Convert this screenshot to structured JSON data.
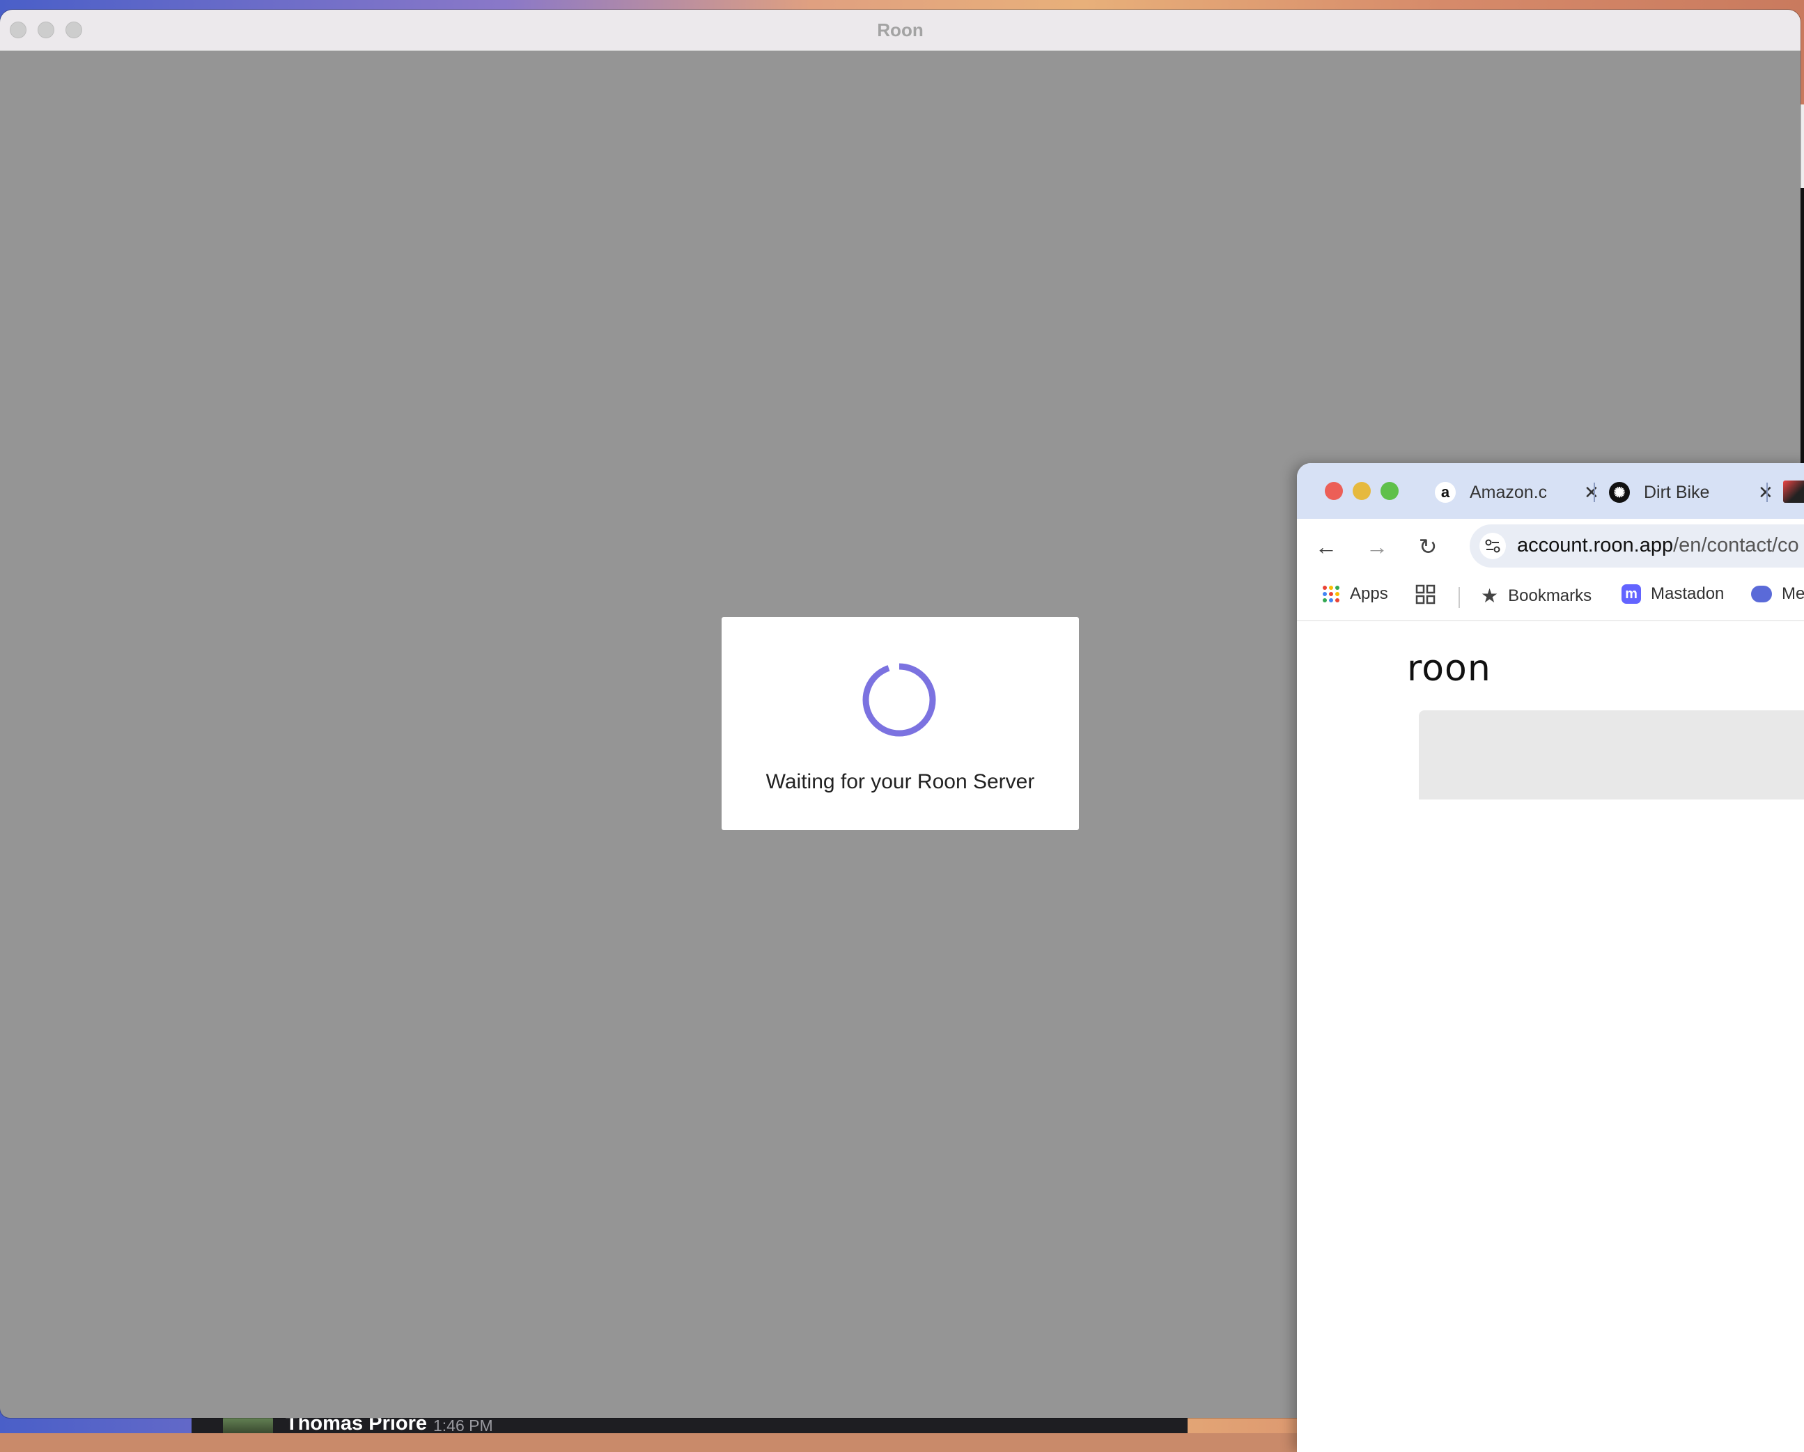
{
  "roon": {
    "title": "Roon",
    "dialog_message": "Waiting for your Roon Server",
    "spinner_color": "#7b72e0"
  },
  "chrome": {
    "tabs": [
      {
        "label": "Amazon.c",
        "icon": "amazon-icon"
      },
      {
        "label": "Dirt Bike",
        "icon": "openai-icon"
      }
    ],
    "url_host": "account.roon.app",
    "url_path": "/en/contact/co",
    "bookmarks": {
      "apps": "Apps",
      "bookmarks": "Bookmarks",
      "mastadon": "Mastadon",
      "partial": "Me"
    },
    "page_logo": "roon"
  },
  "background": {
    "slack_user": "Thomas Priore",
    "slack_time": "1:46 PM"
  }
}
